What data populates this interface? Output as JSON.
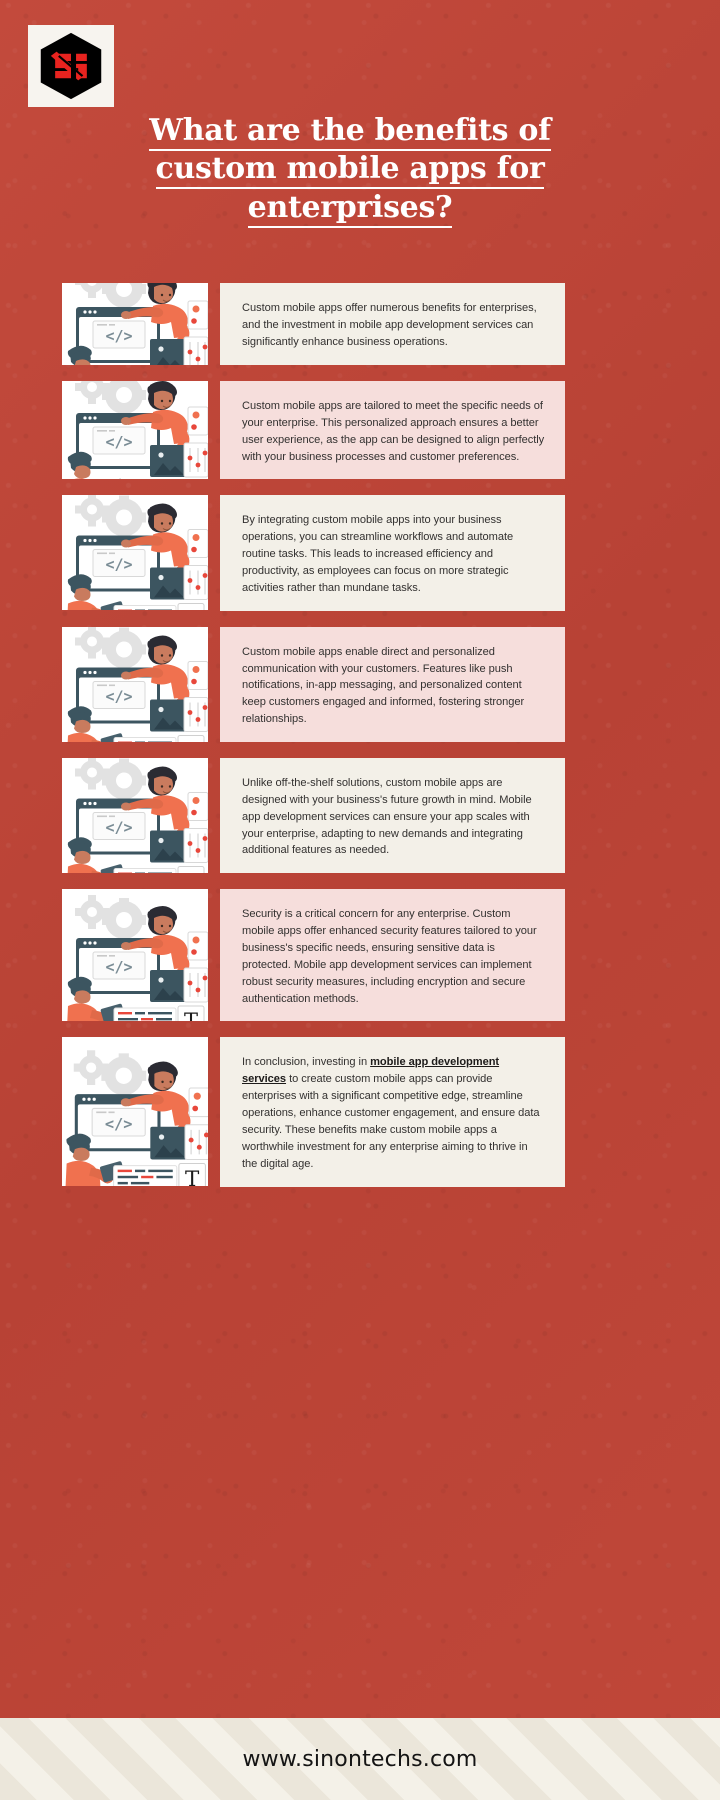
{
  "brand": {
    "logo_icon": "sinontechs-hexagon-logo",
    "background_color": "#be4538",
    "card_cream_color": "#f3f0e8",
    "card_pink_color": "#f6dedc"
  },
  "header": {
    "title_line1": "What are the benefits of",
    "title_line2": "custom mobile apps for",
    "title_line3": "enterprises?"
  },
  "illustration": {
    "icon": "app-development-illustration",
    "alt": "Woman leaning on browser window with code, developer with tablet, design tool panels"
  },
  "cards": [
    {
      "id": "intro",
      "theme": "cream",
      "text": "Custom mobile apps offer numerous benefits for enterprises, and the investment in mobile app development services can significantly enhance business operations."
    },
    {
      "id": "tailored-solutions",
      "theme": "pink",
      "text": "Custom mobile apps are tailored to meet the specific needs of your enterprise. This personalized approach ensures a better user experience, as the app can be designed to align perfectly with your business processes and customer preferences."
    },
    {
      "id": "efficiency-productivity",
      "theme": "cream",
      "text": "By integrating custom mobile apps into your business operations, you can streamline workflows and automate routine tasks. This leads to increased efficiency and productivity, as employees can focus on more strategic activities rather than mundane tasks."
    },
    {
      "id": "customer-engagement",
      "theme": "pink",
      "text": "Custom mobile apps enable direct and personalized communication with your customers. Features like push notifications, in-app messaging, and personalized content keep customers engaged and informed, fostering stronger relationships."
    },
    {
      "id": "scalability",
      "theme": "cream",
      "text": "Unlike off-the-shelf solutions, custom mobile apps are designed with your business's future growth in mind. Mobile app development services can ensure your app scales with your enterprise, adapting to new demands and integrating additional features as needed."
    },
    {
      "id": "security",
      "theme": "pink",
      "text": "Security is a critical concern for any enterprise. Custom mobile apps offer enhanced security features tailored to your business's specific needs, ensuring sensitive data is protected. Mobile app development services can implement robust security measures, including encryption and secure authentication methods."
    },
    {
      "id": "conclusion",
      "theme": "cream",
      "text_before": "In conclusion, investing in ",
      "link_text": "mobile app development services",
      "text_after": " to create custom mobile apps can provide enterprises with a significant competitive edge, streamline operations, enhance customer engagement, and ensure data security. These benefits make custom mobile apps a worthwhile investment for any enterprise aiming to thrive in the digital age."
    }
  ],
  "footer": {
    "website": "www.sinontechs.com"
  }
}
